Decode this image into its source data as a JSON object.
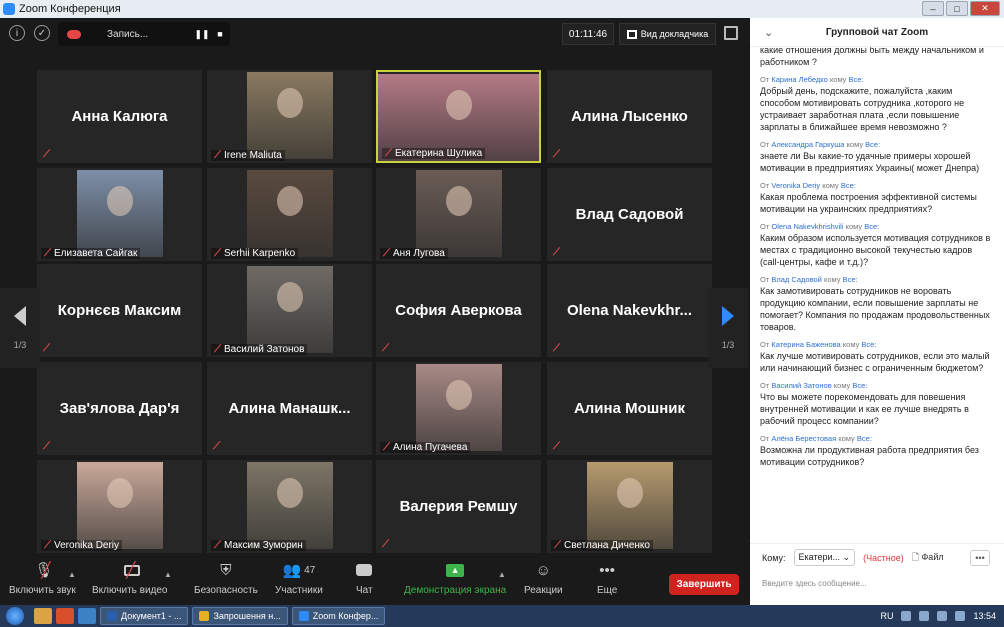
{
  "window": {
    "title": "Zoom Конференция"
  },
  "topbar": {
    "recording_label": "Запись...",
    "timer": "01:11:46",
    "speaker_view": "Вид докладчика"
  },
  "tiles": [
    {
      "name": "Анна Калюга",
      "has_video": false
    },
    {
      "name": "Irene Maliuta",
      "has_video": true,
      "photo_color": "#8a7a60"
    },
    {
      "name": "Екатерина Шулика",
      "has_video": true,
      "active": true,
      "photo_color": "#b57a86"
    },
    {
      "name": "Алина Лысенко",
      "has_video": false
    },
    {
      "name": "Елизавета Сайгак",
      "has_video": true,
      "photo_color": "#7d8fa8"
    },
    {
      "name": "Serhii Karpenko",
      "has_video": true,
      "photo_color": "#5a4a3f"
    },
    {
      "name": "Аня Лугова",
      "has_video": true,
      "photo_color": "#6a5c55"
    },
    {
      "name": "Влад Садовой",
      "has_video": false
    },
    {
      "name": "Корнєєв Максим",
      "has_video": false
    },
    {
      "name": "Василий Затонов",
      "has_video": true,
      "photo_color": "#6f6a66"
    },
    {
      "name": "София Аверкова",
      "has_video": false
    },
    {
      "name": "Olena Nakevkhr...",
      "has_video": false
    },
    {
      "name": "Зав'ялова Дар'я",
      "has_video": false
    },
    {
      "name": "Алина Манашк...",
      "has_video": false
    },
    {
      "name": "Алина Пугачева",
      "has_video": true,
      "photo_color": "#a88a86"
    },
    {
      "name": "Алина Мошник",
      "has_video": false
    },
    {
      "name": "Veronika Deriy",
      "has_video": true,
      "photo_color": "#c9a99a"
    },
    {
      "name": "Максим Зуморин",
      "has_video": true,
      "photo_color": "#7d7566"
    },
    {
      "name": "Валерия Ремшу",
      "has_video": false
    },
    {
      "name": "Светлана Диченко",
      "has_video": true,
      "photo_color": "#b69a6f"
    }
  ],
  "nav": {
    "page_left": "1/3",
    "page_right": "1/3"
  },
  "toolbar": {
    "unmute": "Включить звук",
    "start_video": "Включить видео",
    "security": "Безопасность",
    "participants": "Участники",
    "participants_count": "47",
    "chat": "Чат",
    "share": "Демонстрация экрана",
    "reactions": "Реакции",
    "more": "Еще",
    "end": "Завершить"
  },
  "chat": {
    "title": "Групповой чат Zoom",
    "partial_text": "какие отношения должны быть между начальником и работником ?",
    "messages": [
      {
        "from": "Карина Лебедко",
        "to": "Все:",
        "text": "Добрый день, подскажите, пожалуйста ,каким способом мотивировать сотрудника ,которого не устраивает заработная плата ,если повышение зарплаты в ближайшее время невозможно ?"
      },
      {
        "from": "Александра Гаркуша",
        "to": "Все:",
        "text": "знаете ли Вы какие-то удачные примеры хорошей мотивации в предприятиях Украины( может Днепра)"
      },
      {
        "from": "Veronika Deriy",
        "to": "Все:",
        "text": "Какая проблема построения эффективной системы мотивации на украинских предприятиях?"
      },
      {
        "from": "Olena Nakevkhrishvili",
        "to": "Все:",
        "text": "Каким образом используется мотивация сотрудников в местах с традиционно высокой текучестью кадров (call-центры, кафе и т.д.)?"
      },
      {
        "from": "Влад Садовой",
        "to": "Все:",
        "text": "Как замотивировать сотрудников не воровать продукцию компании, если повышение зарплаты не помогает? Компания по продажам продовольственных товаров."
      },
      {
        "from": "Катерина Баженова",
        "to": "Все:",
        "text": "Как лучше мотивировать сотрудников,  если это малый или начинающий бизнес с ограниченным бюджетом?"
      },
      {
        "from": "Василий Затонов",
        "to": "Все:",
        "text": "Что вы можете порекомендовать для повешения внутренней мотивации и как ее лучше внедрять в рабочий процесс компании?"
      },
      {
        "from": "Алёна Берестовая",
        "to": "Все:",
        "text": "Возможна ли продуктивная работа предприятия без мотивации сотрудников?"
      }
    ],
    "from_prefix": "От",
    "to_prefix": "кому",
    "to_label": "Кому:",
    "recipient": "Екатери...",
    "private": "(Частное)",
    "file": "Файл",
    "input_placeholder": "Введите здесь сообщение..."
  },
  "taskbar": {
    "items": [
      "Документ1 - ...",
      "Запрошення н...",
      "Zoom Конфер..."
    ],
    "lang": "RU",
    "time": "13:54"
  }
}
